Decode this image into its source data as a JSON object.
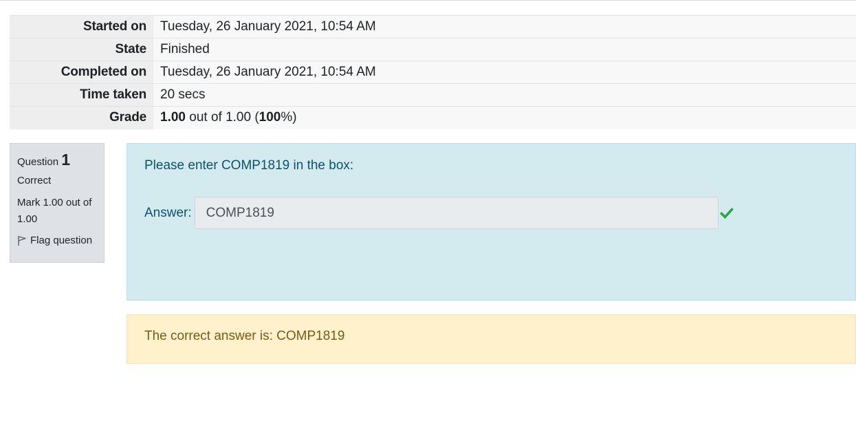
{
  "summary": {
    "rows": [
      {
        "label": "Started on",
        "value": "Tuesday, 26 January 2021, 10:54 AM"
      },
      {
        "label": "State",
        "value": "Finished"
      },
      {
        "label": "Completed on",
        "value": "Tuesday, 26 January 2021, 10:54 AM"
      },
      {
        "label": "Time taken",
        "value": "20 secs"
      }
    ],
    "grade": {
      "label": "Grade",
      "score": "1.00",
      "mid": " out of 1.00 (",
      "percent": "100",
      "tail": "%)"
    }
  },
  "question_info": {
    "prefix": "Question",
    "number": "1",
    "state": "Correct",
    "grade": "Mark 1.00 out of 1.00",
    "flag_label": "Flag question",
    "flag_icon": "flag-outline-icon"
  },
  "formulation": {
    "question_text": "Please enter COMP1819 in the box:",
    "answer_label": "Answer:",
    "answer_value": "COMP1819",
    "correct_icon": "check-icon",
    "correct_color": "#28a745"
  },
  "outcome": {
    "right_answer": "The correct answer is: COMP1819"
  }
}
